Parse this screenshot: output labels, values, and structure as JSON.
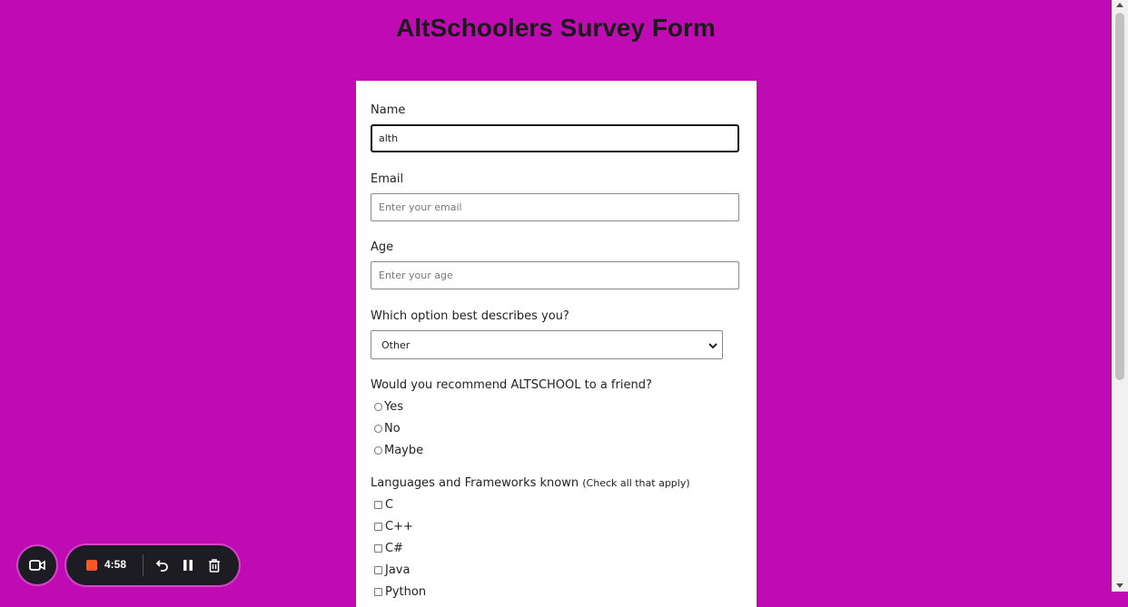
{
  "page": {
    "title": "AltSchoolers Survey Form",
    "background": "#c00ab4"
  },
  "form": {
    "name": {
      "label": "Name",
      "value": "alth",
      "placeholder": ""
    },
    "email": {
      "label": "Email",
      "value": "",
      "placeholder": "Enter your email"
    },
    "age": {
      "label": "Age",
      "value": "",
      "placeholder": "Enter your age"
    },
    "role": {
      "label": "Which option best describes you?",
      "selected": "Other"
    },
    "recommend": {
      "label": "Would you recommend ALTSCHOOL to a friend?",
      "options": [
        "Yes",
        "No",
        "Maybe"
      ]
    },
    "languages": {
      "label": "Languages and Frameworks known",
      "note": "(Check all that apply)",
      "options": [
        "C",
        "C++",
        "C#",
        "Java",
        "Python"
      ]
    }
  },
  "recorder": {
    "time": "4:58",
    "icons": [
      "camera-icon",
      "stop-icon",
      "undo-icon",
      "pause-icon",
      "trash-icon"
    ],
    "accent": "#ff5722"
  }
}
